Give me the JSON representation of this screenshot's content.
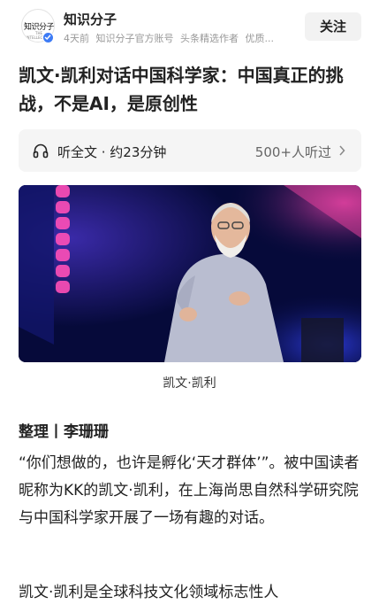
{
  "header": {
    "avatar_brand": "知识分子",
    "avatar_sub": "THE INTELLECTUAL",
    "account_name": "知识分子",
    "meta": [
      "4天前",
      "知识分子官方账号",
      "头条精选作者",
      "优质..."
    ],
    "follow_label": "关注"
  },
  "article": {
    "title": "凯文·凯利对话中国科学家：中国真正的挑战，不是AI，是原创性",
    "listen": {
      "label": "听全文 · 约23分钟",
      "count": "500+人听过"
    },
    "image_caption": "凯文·凯利",
    "byline": "整理丨李珊珊",
    "paragraphs": [
      "“你们想做的，也许是孵化‘天才群体’”。被中国读者昵称为KK的凯文·凯利，在上海尚思自然科学研究院与中国科学家开展了一场有趣的对话。",
      "凯文·凯利是全球科技文化领域标志性人"
    ]
  },
  "colors": {
    "verified_badge": "#3d7bf5",
    "stage_background": "#060a3a",
    "stage_light": "#e0409a"
  },
  "icons": [
    "verified-icon",
    "headphones-icon",
    "chevron-right-icon"
  ]
}
